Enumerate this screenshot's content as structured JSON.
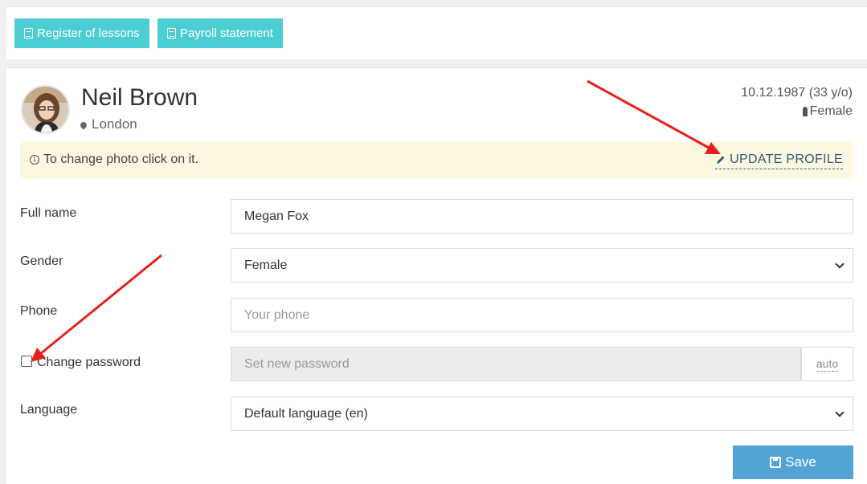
{
  "toolbar": {
    "register_label": "Register of lessons",
    "payroll_label": "Payroll statement"
  },
  "profile": {
    "name": "Neil Brown",
    "city": "London",
    "birthdate": "10.12.1987 (33 y/o)",
    "gender": "Female"
  },
  "info": {
    "message": "To change photo click on it.",
    "update_label": "UPDATE PROFILE"
  },
  "form": {
    "full_name_label": "Full name",
    "full_name_value": "Megan Fox",
    "gender_label": "Gender",
    "gender_value": "Female",
    "phone_label": "Phone",
    "phone_placeholder": "Your phone",
    "change_password_label": "Change password",
    "password_placeholder": "Set new password",
    "auto_label": "auto",
    "language_label": "Language",
    "language_value": "Default language (en)",
    "save_label": "Save"
  },
  "colors": {
    "toolbar_button": "#4ccdd3",
    "info_bar": "#fcf7e1",
    "save_button": "#54a3d7",
    "annotation_arrow": "#e8201c"
  }
}
